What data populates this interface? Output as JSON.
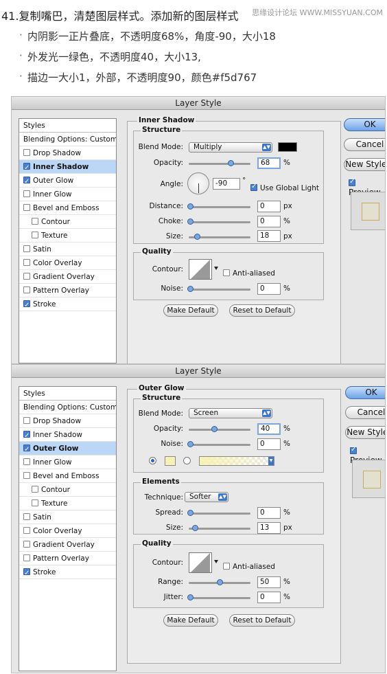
{
  "intro": {
    "title": "41.复制嘴巴，清楚图层样式。添加新的图层样式",
    "watermark": "思缘设计论坛 WWW.MISSYUAN.COM",
    "lines": [
      "内阴影一正片叠底，不透明度68%，角度-90，大小18",
      "外发光一绿色，不透明度40，大小13,",
      "描边一大小1，外部，不透明度90，颜色#f5d767"
    ]
  },
  "styles_list": {
    "header": "Styles",
    "blending": "Blending Options: Custom",
    "drop_shadow": "Drop Shadow",
    "inner_shadow": "Inner Shadow",
    "outer_glow": "Outer Glow",
    "inner_glow": "Inner Glow",
    "bevel": "Bevel and Emboss",
    "contour": "Contour",
    "texture": "Texture",
    "satin": "Satin",
    "color_overlay": "Color Overlay",
    "gradient_overlay": "Gradient Overlay",
    "pattern_overlay": "Pattern Overlay",
    "stroke": "Stroke"
  },
  "buttons": {
    "ok": "OK",
    "cancel": "Cancel",
    "new_style": "New Style...",
    "preview": "Preview",
    "make_default": "Make Default",
    "reset_default": "Reset to Default"
  },
  "common": {
    "window_title": "Layer Style",
    "structure": "Structure",
    "quality": "Quality",
    "elements": "Elements",
    "blend_mode": "Blend Mode:",
    "opacity": "Opacity:",
    "noise": "Noise:",
    "angle": "Angle:",
    "use_global": "Use Global Light",
    "distance": "Distance:",
    "choke": "Choke:",
    "size": "Size:",
    "contour": "Contour:",
    "anti_aliased": "Anti-aliased",
    "technique": "Technique:",
    "spread": "Spread:",
    "range": "Range:",
    "jitter": "Jitter:",
    "px": "px",
    "pct": "%",
    "deg": "°"
  },
  "inner_shadow": {
    "section": "Inner Shadow",
    "blend_mode": "Multiply",
    "shadow_color": "#000000",
    "opacity": "68",
    "angle": "-90",
    "distance": "0",
    "choke": "0",
    "size": "18",
    "noise": "0",
    "use_global_light": true,
    "anti_aliased": false
  },
  "outer_glow": {
    "section": "Outer Glow",
    "blend_mode": "Screen",
    "opacity": "40",
    "noise": "0",
    "glow_color": "#f7f2b4",
    "technique": "Softer",
    "spread": "0",
    "size": "13",
    "range": "50",
    "jitter": "0",
    "anti_aliased": false
  },
  "colors": {
    "selection": "#bcd6f5",
    "ok_button": "#6fa3e8",
    "stroke_color": "#f5d767"
  }
}
